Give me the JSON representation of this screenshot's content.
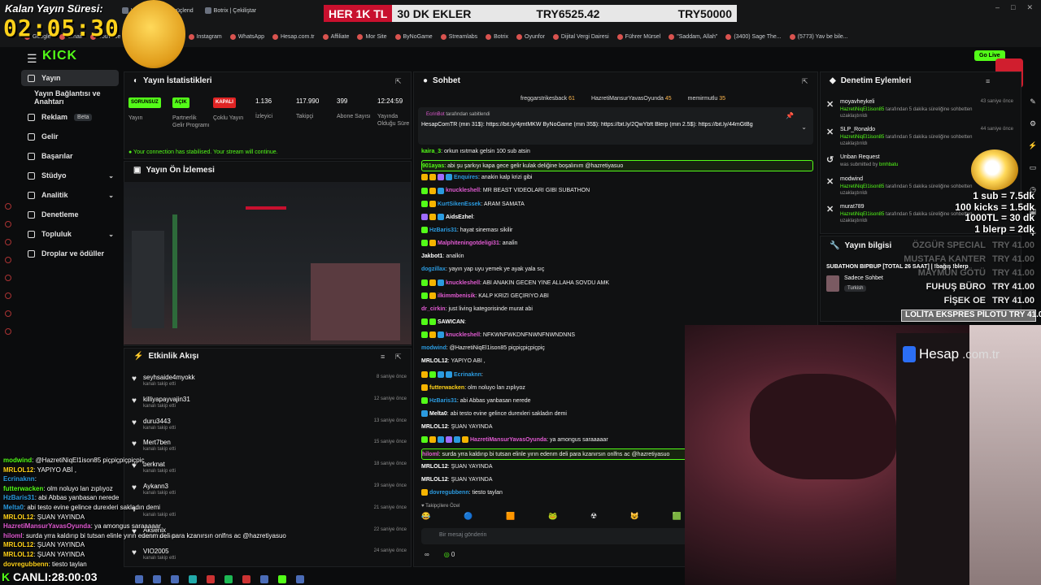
{
  "browser": {
    "tabs": [
      "Widgets | Yayını güçlend",
      "Botrix | Çekiliştar"
    ],
    "bookmarks": [
      "Google",
      "Gmail",
      "YouTube",
      "Kick | Dashboard",
      "Instagram",
      "WhatsApp",
      "Hesap.com.tr",
      "Affiliate",
      "Mor Site",
      "ByNoGame",
      "Streamlabs",
      "Botrix",
      "Oyunfor",
      "Dijital Vergi Dairesi",
      "Führer Mürsel",
      "\"Saddam, Allah\"",
      "(3400) Sage The...",
      "(5773) Yav be bile..."
    ],
    "window_controls": [
      "–",
      "□",
      "✕"
    ]
  },
  "stream_overlay": {
    "timer_title": "Kalan Yayın Süresi:",
    "timer": "02:05:30",
    "banner_red": "HER 1K TL",
    "banner_text": "30 DK EKLER",
    "banner_current": "TRY6525.42",
    "banner_goal": "TRY50000",
    "sub_rates": [
      "1 sub = 7.5dk",
      "100 kicks = 1.5dk",
      "1000TL = 30 dk",
      "1 blerp = 2dk"
    ],
    "specials": [
      {
        "name": "ÖZGÜR SPECIAL",
        "price": "TRY 41.00"
      },
      {
        "name": "MUSTAFA KANTER",
        "price": "TRY 41.00"
      },
      {
        "name": "MAYMUN GÖTÜ",
        "price": "TRY 41.00"
      },
      {
        "name": "FUHUŞ BÜRO",
        "price": "TRY 41.00"
      },
      {
        "name": "FİŞEK OE",
        "price": "TRY 41.00"
      }
    ],
    "lolita": "LOLİTA EKSPRES PİLOTU  TRY 41.00",
    "hesap_brand": "Hesap",
    "hesap_domain": ".com.tr",
    "live_label": "CANLI:",
    "live_time": "28:00:03",
    "overlay_chat": [
      {
        "user": "modwind",
        "msg": "@HazretiNiqEl1ison85 piçpiçpiçpiçpiç",
        "color": "#53fc18"
      },
      {
        "user": "MRLOL12",
        "msg": "YAPIYO ABİ ,",
        "color": "#ffd21a"
      },
      {
        "user": "Ecrinaknn",
        "msg": "",
        "color": "#2b9be0"
      },
      {
        "user": "futterwacken",
        "msg": "olm noluyo lan zıplıyoz",
        "color": "#53fc18"
      },
      {
        "user": "HzBaris31",
        "msg": "abi Abbas yanbasan nerede",
        "color": "#2b9be0"
      },
      {
        "user": "Melta0",
        "msg": "abi testo evine gelince durexleri sakladın demi",
        "color": "#2b9be0"
      },
      {
        "user": "MRLOL12",
        "msg": "ŞUAN YAYINDA",
        "color": "#ffd21a"
      },
      {
        "user": "HazretiMansurYavasOyunda",
        "msg": "ya amongus saraaaaar",
        "color": "#e05ad1"
      },
      {
        "user": "hiloml",
        "msg": "surda yrra kaldırıp bi tutsan elinle yırın edenm deli para kzanırsın onlfns ac @hazretiyasuo",
        "color": "#e05ad1"
      },
      {
        "user": "MRLOL12",
        "msg": "ŞUAN YAYINDA",
        "color": "#ffd21a"
      },
      {
        "user": "MRLOL12",
        "msg": "ŞUAN YAYINDA",
        "color": "#ffd21a"
      },
      {
        "user": "dovregubbenn",
        "msg": "tiesto taylan",
        "color": "#ffd21a"
      }
    ]
  },
  "app": {
    "logo": "KICK",
    "go_live": "Go Live",
    "sidebar": [
      {
        "label": "Yayın",
        "active": true,
        "chevron": false
      },
      {
        "label": "Yayın Bağlantısı ve Anahtarı",
        "active": false,
        "chevron": false
      },
      {
        "label": "Reklam",
        "active": false,
        "chevron": false,
        "badge": "Beta"
      },
      {
        "label": "Gelir",
        "active": false,
        "chevron": false
      },
      {
        "label": "Başarılar",
        "active": false,
        "chevron": false
      },
      {
        "label": "Stüdyo",
        "active": false,
        "chevron": true
      },
      {
        "label": "Analitik",
        "active": false,
        "chevron": true
      },
      {
        "label": "Denetleme",
        "active": false,
        "chevron": false
      },
      {
        "label": "Topluluk",
        "active": false,
        "chevron": true
      },
      {
        "label": "Droplar ve ödüller",
        "active": false,
        "chevron": false
      }
    ]
  },
  "stats_panel": {
    "title": "Yayın İstatistikleri",
    "items": [
      {
        "badge": "SORUNSUZ",
        "badge_color": "green",
        "label": "Yayın"
      },
      {
        "badge": "AÇIK",
        "badge_color": "green",
        "label": "Partnerlik Gelir Programı"
      },
      {
        "badge": "KAPALI",
        "badge_color": "red",
        "label": "Çoklu Yayın"
      },
      {
        "value": "1.136",
        "label": "İzleyici"
      },
      {
        "value": "117.990",
        "label": "Takipçi"
      },
      {
        "value": "399",
        "label": "Abone Sayısı"
      },
      {
        "value": "12:24:59",
        "label": "Yayında Olduğu Süre"
      }
    ],
    "status": "Your connection has stabilised. Your stream will continue."
  },
  "preview_panel": {
    "title": "Yayın Ön İzlemesi"
  },
  "activity_panel": {
    "title": "Etkinlik Akışı",
    "items": [
      {
        "name": "seyhsaide4myokk",
        "sub": "kanalı takip etti",
        "time": "8 saniye önce"
      },
      {
        "name": "killiyapayvajin31",
        "sub": "kanalı takip etti",
        "time": "12 saniye önce"
      },
      {
        "name": "duru3443",
        "sub": "kanalı takip etti",
        "time": "13 saniye önce"
      },
      {
        "name": "Mert7ben",
        "sub": "kanalı takip etti",
        "time": "15 saniye önce"
      },
      {
        "name": "berknat",
        "sub": "kanalı takip etti",
        "time": "18 saniye önce"
      },
      {
        "name": "Aykann3",
        "sub": "kanalı takip etti",
        "time": "19 saniye önce"
      },
      {
        "name": "",
        "sub": "kanalı takip etti",
        "time": "21 saniye önce"
      },
      {
        "name": "Aksenix",
        "sub": "kanalı takip etti",
        "time": "22 saniye önce"
      },
      {
        "name": "VIO2005",
        "sub": "kanalı takip etti",
        "time": "24 saniye önce"
      }
    ]
  },
  "chat_panel": {
    "title": "Sohbet",
    "top_gifters": [
      {
        "name": "freggarstrikesback",
        "count": "61"
      },
      {
        "name": "HazretiMansurYavasOyunda",
        "count": "45"
      },
      {
        "name": "memirmutlu",
        "count": "35"
      }
    ],
    "pinned_by": "EcrinBot",
    "pinned_suffix": "tarafından sabitlendi",
    "pinned_text": "HesapComTR (min 31$): https://bit.ly/4jmtMKW ByNoGame (min 35$): https://bit.ly/2QwYbft Blerp (min 2.5$): https://bit.ly/44mGtBg",
    "messages": [
      {
        "user": "kaira_3",
        "msg": "orkun ısıtmak gelsin 100 sub atsin",
        "color": "#53fc18",
        "badges": []
      },
      {
        "user": "901ayas",
        "msg": "abi şu şarkıyı kapa gece gelir kulak deliğine boşalınım @hazretiyasuo",
        "color": "#53fc18",
        "badges": [],
        "highlight": true
      },
      {
        "user": "Enquires",
        "msg": "anakin kalp krizi gibi",
        "color": "#2b9be0",
        "badges": [
          "y",
          "y",
          "p",
          "b"
        ]
      },
      {
        "user": "knuckleshell",
        "msg": "MR BEAST VİDEOLARI GİBİ SUBATHON",
        "color": "#e05ad1",
        "badges": [
          "g",
          "y",
          "b"
        ]
      },
      {
        "user": "KurtSikenEssek",
        "msg": "ARAM SAMATA",
        "color": "#2b9be0",
        "badges": [
          "g",
          "y"
        ]
      },
      {
        "user": "AidsEzhel",
        "msg": "",
        "color": "#ffffff",
        "badges": [
          "p",
          "y",
          "b"
        ]
      },
      {
        "user": "HzBaris31",
        "msg": "hayat sineması sikilir",
        "color": "#2b9be0",
        "badges": [
          "g"
        ]
      },
      {
        "user": "Malphiteningotdeligi31",
        "msg": "anali̇n",
        "color": "#e05ad1",
        "badges": [
          "g",
          "y"
        ]
      },
      {
        "user": "Jakbot1",
        "msg": "analkin",
        "color": "#ffffff",
        "badges": []
      },
      {
        "user": "dogzillax",
        "msg": "yayın yap uyu yemek ye ayak yala sıç",
        "color": "#2b9be0",
        "badges": []
      },
      {
        "user": "knuckleshell",
        "msg": "ABİ ANAKİN GECEN YİNE ALLAHA SOVDU AMK",
        "color": "#e05ad1",
        "badges": [
          "g",
          "y",
          "b"
        ]
      },
      {
        "user": "ilkimmbenisik",
        "msg": "KALP KRİZİ GEÇİRİYO ABİ",
        "color": "#e05ad1",
        "badges": [
          "g",
          "y"
        ]
      },
      {
        "user": "dr_cirkin",
        "msg": "just living kategorisinde murat abi",
        "color": "#e05ad1",
        "badges": []
      },
      {
        "user": "SAWICAN",
        "msg": "",
        "color": "#ffffff",
        "badges": [
          "g",
          "g"
        ]
      },
      {
        "user": "knuckleshell",
        "msg": "NFKWNFWKDNFNWNFNWNDNNS",
        "color": "#e05ad1",
        "badges": [
          "g",
          "y",
          "b"
        ]
      },
      {
        "user": "modwind",
        "msg": "@HazretiNiqEl1ison85 piçpiçpiçpiçpiç",
        "color": "#2b9be0",
        "badges": []
      },
      {
        "user": "MRLOL12",
        "msg": "YAPIYO ABİ ,",
        "color": "#ffffff",
        "badges": []
      },
      {
        "user": "Ecrinaknn",
        "msg": "",
        "color": "#2b9be0",
        "badges": [
          "y",
          "g",
          "b",
          "b"
        ]
      },
      {
        "user": "futterwacken",
        "msg": "olm noluyo lan zıplıyoz",
        "color": "#ffd21a",
        "badges": [
          "y"
        ]
      },
      {
        "user": "HzBaris31",
        "msg": "abi Abbas yanbasan nerede",
        "color": "#2b9be0",
        "badges": [
          "g"
        ]
      },
      {
        "user": "Melta0",
        "msg": "abi testo evine gelince durexleri sakladın demi",
        "color": "#ffffff",
        "badges": [
          "b"
        ]
      },
      {
        "user": "MRLOL12",
        "msg": "ŞUAN YAYINDA",
        "color": "#ffffff",
        "badges": []
      },
      {
        "user": "HazretiMansurYavasOyunda",
        "msg": "ya amongus saraaaaar",
        "color": "#e05ad1",
        "badges": [
          "g",
          "y",
          "b",
          "p",
          "b",
          "y"
        ]
      },
      {
        "user": "hiloml",
        "msg": "surda yrra kaldırıp bi tutsan elinle yırın edenm deli para kzanırsın onlfns ac @hazretiyasuo",
        "color": "#e05ad1",
        "badges": [],
        "highlight": true
      },
      {
        "user": "MRLOL12",
        "msg": "ŞUAN YAYINDA",
        "color": "#ffffff",
        "badges": []
      },
      {
        "user": "MRLOL12",
        "msg": "ŞUAN YAYINDA",
        "color": "#ffffff",
        "badges": []
      },
      {
        "user": "dovregubbenn",
        "msg": "tiesto taylan",
        "color": "#2b9be0",
        "badges": [
          "y"
        ]
      }
    ],
    "emote_bar_label": "Takipçilere Özel",
    "input_placeholder": "Bir mesaj gönderin",
    "footer_count": "0"
  },
  "mod_panel": {
    "title": "Denetim Eylemleri",
    "items": [
      {
        "icon": "✕",
        "name": "moyavheykeli",
        "by": "HazretiNiqEl1ison85",
        "desc": " tarafından 5 dakika süreliğine sohbetten uzaklaştırıldı",
        "time": "43 saniye önce"
      },
      {
        "icon": "✕",
        "name": "SLP_Ronaldo",
        "by": "HazretiNiqEl1ison85",
        "desc": " tarafından 5 dakika süreliğine sohbetten uzaklaştırıldı",
        "time": "44 saniye önce"
      },
      {
        "icon": "↺",
        "name": "Unban Request",
        "by": "bmhbatu",
        "desc": "was submitted by ",
        "time": "",
        "pre": true
      },
      {
        "icon": "✕",
        "name": "modwind",
        "by": "HazretiNiqEl1ison85",
        "desc": " tarafından 5 dakika süreliğine sohbetten uzaklaştırıldı",
        "time": ""
      },
      {
        "icon": "✕",
        "name": "murat789",
        "by": "HazretiNiqEl1ison85",
        "desc": " tarafından 5 dakika süreliğine sohbetten uzaklaştırıldı",
        "time": ""
      }
    ]
  },
  "info_panel": {
    "title": "Yayın bilgisi",
    "stream_title": "SUBATHON BIPBUP [TOTAL 26 SAAT] | !bağış !blerp",
    "category": "Sadece Sohbet",
    "language": "Turkish"
  },
  "colors": {
    "kick_green": "#53fc18",
    "red": "#c8102e",
    "timer_yellow": "#ffd21a"
  }
}
